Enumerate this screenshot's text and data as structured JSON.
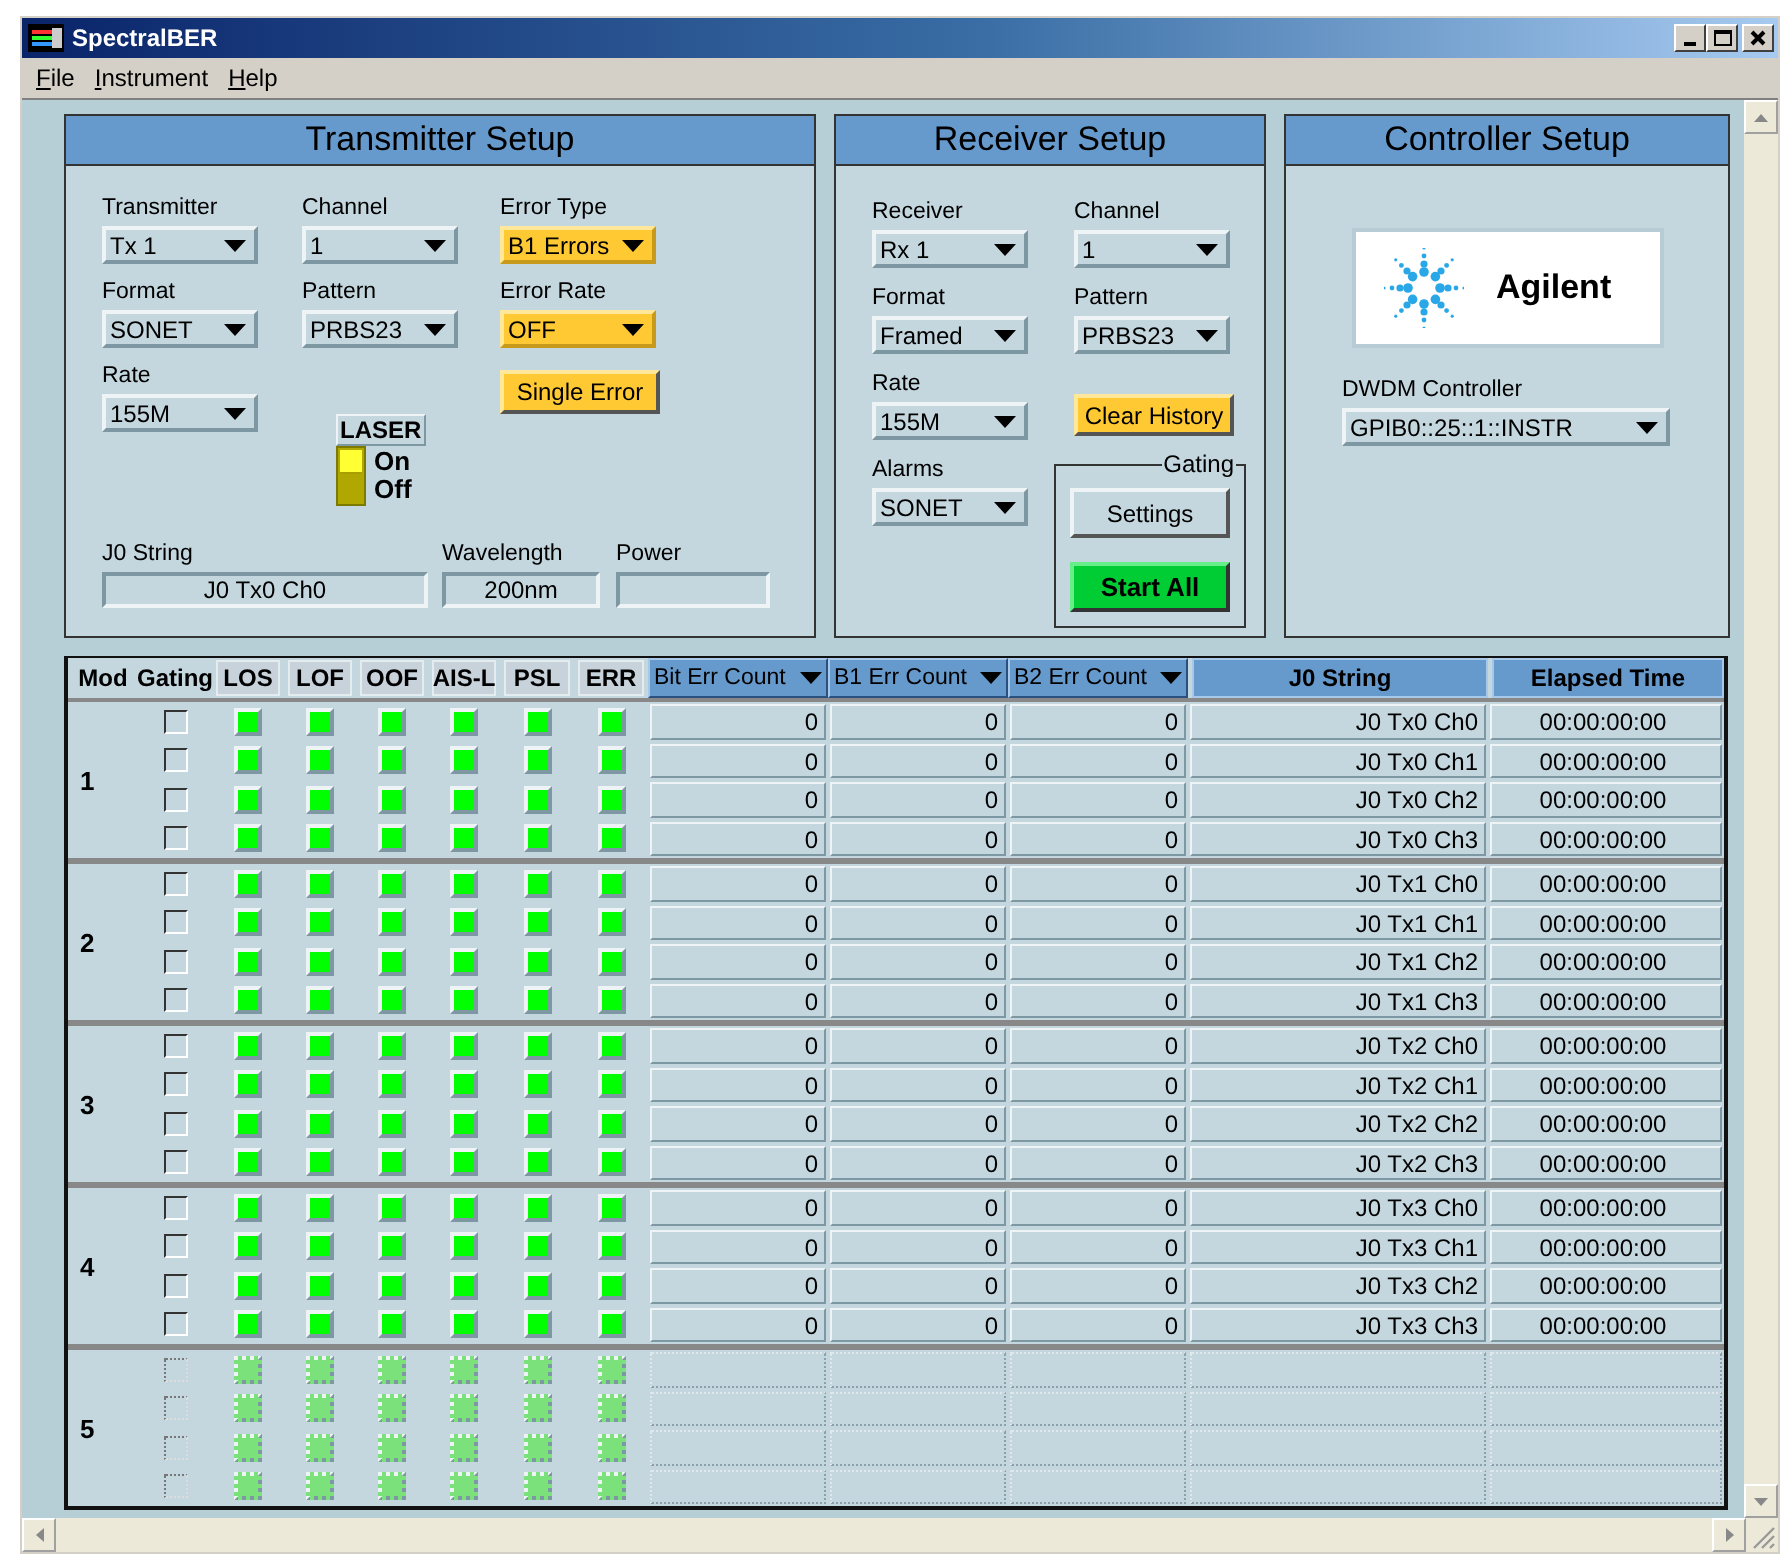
{
  "window": {
    "title": "SpectralBER"
  },
  "menu": [
    "File",
    "Instrument",
    "Help"
  ],
  "transmitter": {
    "title": "Transmitter Setup",
    "fields": [
      {
        "label": "Transmitter",
        "value": "Tx 1",
        "highlighted": false
      },
      {
        "label": "Channel",
        "value": "1",
        "highlighted": false
      },
      {
        "label": "Error Type",
        "value": "B1 Errors",
        "highlighted": true
      },
      {
        "label": "Format",
        "value": "SONET",
        "highlighted": false
      },
      {
        "label": "Pattern",
        "value": "PRBS23",
        "highlighted": false
      },
      {
        "label": "Error Rate",
        "value": "OFF",
        "highlighted": true
      },
      {
        "label": "Rate",
        "value": "155M",
        "highlighted": false
      }
    ],
    "laser": {
      "title": "LASER",
      "on": true,
      "on_label": "On",
      "off_label": "Off"
    },
    "single_error_button": "Single Error",
    "readouts": [
      {
        "label": "J0 String",
        "value": "J0 Tx0 Ch0"
      },
      {
        "label": "Wavelength",
        "value": "200nm"
      },
      {
        "label": "Power"
      }
    ]
  },
  "receiver": {
    "title": "Receiver Setup",
    "fields": [
      {
        "label": "Receiver",
        "value": "Rx 1"
      },
      {
        "label": "Channel",
        "value": "1"
      },
      {
        "label": "Format",
        "value": "Framed"
      },
      {
        "label": "Pattern",
        "value": "PRBS23"
      },
      {
        "label": "Rate",
        "value": "155M"
      },
      {
        "label": "Alarms",
        "value": "SONET"
      }
    ],
    "clear_history_button": "Clear History",
    "gating": {
      "title": "Gating",
      "settings_button": "Settings",
      "start_button": "Start All"
    }
  },
  "controller": {
    "title": "Controller Setup",
    "logo": {
      "text": "Agilent"
    },
    "fields": [
      {
        "label": "DWDM Controller",
        "value": "GPIB0::25::1::INSTR"
      }
    ]
  },
  "table": {
    "columns": [
      {
        "label": "Mod",
        "kind": "plain"
      },
      {
        "label": "Gating",
        "kind": "plain"
      },
      {
        "label": "LOS",
        "kind": "boxed"
      },
      {
        "label": "LOF",
        "kind": "boxed"
      },
      {
        "label": "OOF",
        "kind": "boxed"
      },
      {
        "label": "AIS-L",
        "kind": "boxed"
      },
      {
        "label": "PSL",
        "kind": "boxed"
      },
      {
        "label": "ERR",
        "kind": "boxed"
      },
      {
        "label": "Bit Err Count",
        "kind": "sortable"
      },
      {
        "label": "B1 Err Count",
        "kind": "sortable"
      },
      {
        "label": "B2 Err Count",
        "kind": "sortable"
      },
      {
        "label": "J0 String",
        "kind": "title"
      },
      {
        "label": "Elapsed Time",
        "kind": "title"
      }
    ],
    "modules": [
      {
        "number": "1",
        "disabled": false,
        "rows": [
          {
            "gating": false,
            "alarms": [
              false,
              false,
              false,
              false,
              false,
              false
            ],
            "bit_err_count": "0",
            "b1_err_count": "0",
            "b2_err_count": "0",
            "j0_string": "J0 Tx0 Ch0",
            "elapsed_time": "00:00:00:00"
          },
          {
            "gating": false,
            "alarms": [
              false,
              false,
              false,
              false,
              false,
              false
            ],
            "bit_err_count": "0",
            "b1_err_count": "0",
            "b2_err_count": "0",
            "j0_string": "J0 Tx0 Ch1",
            "elapsed_time": "00:00:00:00"
          },
          {
            "gating": false,
            "alarms": [
              false,
              false,
              false,
              false,
              false,
              false
            ],
            "bit_err_count": "0",
            "b1_err_count": "0",
            "b2_err_count": "0",
            "j0_string": "J0 Tx0 Ch2",
            "elapsed_time": "00:00:00:00"
          },
          {
            "gating": false,
            "alarms": [
              false,
              false,
              false,
              false,
              false,
              false
            ],
            "bit_err_count": "0",
            "b1_err_count": "0",
            "b2_err_count": "0",
            "j0_string": "J0 Tx0 Ch3",
            "elapsed_time": "00:00:00:00"
          }
        ]
      },
      {
        "number": "2",
        "disabled": false,
        "rows": [
          {
            "gating": false,
            "alarms": [
              false,
              false,
              false,
              false,
              false,
              false
            ],
            "bit_err_count": "0",
            "b1_err_count": "0",
            "b2_err_count": "0",
            "j0_string": "J0 Tx1 Ch0",
            "elapsed_time": "00:00:00:00"
          },
          {
            "gating": false,
            "alarms": [
              false,
              false,
              false,
              false,
              false,
              false
            ],
            "bit_err_count": "0",
            "b1_err_count": "0",
            "b2_err_count": "0",
            "j0_string": "J0 Tx1 Ch1",
            "elapsed_time": "00:00:00:00"
          },
          {
            "gating": false,
            "alarms": [
              false,
              false,
              false,
              false,
              false,
              false
            ],
            "bit_err_count": "0",
            "b1_err_count": "0",
            "b2_err_count": "0",
            "j0_string": "J0 Tx1 Ch2",
            "elapsed_time": "00:00:00:00"
          },
          {
            "gating": false,
            "alarms": [
              false,
              false,
              false,
              false,
              false,
              false
            ],
            "bit_err_count": "0",
            "b1_err_count": "0",
            "b2_err_count": "0",
            "j0_string": "J0 Tx1 Ch3",
            "elapsed_time": "00:00:00:00"
          }
        ]
      },
      {
        "number": "3",
        "disabled": false,
        "rows": [
          {
            "gating": false,
            "alarms": [
              false,
              false,
              false,
              false,
              false,
              false
            ],
            "bit_err_count": "0",
            "b1_err_count": "0",
            "b2_err_count": "0",
            "j0_string": "J0 Tx2 Ch0",
            "elapsed_time": "00:00:00:00"
          },
          {
            "gating": false,
            "alarms": [
              false,
              false,
              false,
              false,
              false,
              false
            ],
            "bit_err_count": "0",
            "b1_err_count": "0",
            "b2_err_count": "0",
            "j0_string": "J0 Tx2 Ch1",
            "elapsed_time": "00:00:00:00"
          },
          {
            "gating": false,
            "alarms": [
              false,
              false,
              false,
              false,
              false,
              false
            ],
            "bit_err_count": "0",
            "b1_err_count": "0",
            "b2_err_count": "0",
            "j0_string": "J0 Tx2 Ch2",
            "elapsed_time": "00:00:00:00"
          },
          {
            "gating": false,
            "alarms": [
              false,
              false,
              false,
              false,
              false,
              false
            ],
            "bit_err_count": "0",
            "b1_err_count": "0",
            "b2_err_count": "0",
            "j0_string": "J0 Tx2 Ch3",
            "elapsed_time": "00:00:00:00"
          }
        ]
      },
      {
        "number": "4",
        "disabled": false,
        "rows": [
          {
            "gating": false,
            "alarms": [
              false,
              false,
              false,
              false,
              false,
              false
            ],
            "bit_err_count": "0",
            "b1_err_count": "0",
            "b2_err_count": "0",
            "j0_string": "J0 Tx3 Ch0",
            "elapsed_time": "00:00:00:00"
          },
          {
            "gating": false,
            "alarms": [
              false,
              false,
              false,
              false,
              false,
              false
            ],
            "bit_err_count": "0",
            "b1_err_count": "0",
            "b2_err_count": "0",
            "j0_string": "J0 Tx3 Ch1",
            "elapsed_time": "00:00:00:00"
          },
          {
            "gating": false,
            "alarms": [
              false,
              false,
              false,
              false,
              false,
              false
            ],
            "bit_err_count": "0",
            "b1_err_count": "0",
            "b2_err_count": "0",
            "j0_string": "J0 Tx3 Ch2",
            "elapsed_time": "00:00:00:00"
          },
          {
            "gating": false,
            "alarms": [
              false,
              false,
              false,
              false,
              false,
              false
            ],
            "bit_err_count": "0",
            "b1_err_count": "0",
            "b2_err_count": "0",
            "j0_string": "J0 Tx3 Ch3",
            "elapsed_time": "00:00:00:00"
          }
        ]
      },
      {
        "number": "5",
        "disabled": true,
        "rows": [
          {
            "gating": false,
            "alarms": [
              false,
              false,
              false,
              false,
              false,
              false
            ]
          },
          {
            "gating": false,
            "alarms": [
              false,
              false,
              false,
              false,
              false,
              false
            ]
          },
          {
            "gating": false,
            "alarms": [
              false,
              false,
              false,
              false,
              false,
              false
            ]
          },
          {
            "gating": false,
            "alarms": [
              false,
              false,
              false,
              false,
              false,
              false
            ]
          }
        ]
      }
    ]
  }
}
